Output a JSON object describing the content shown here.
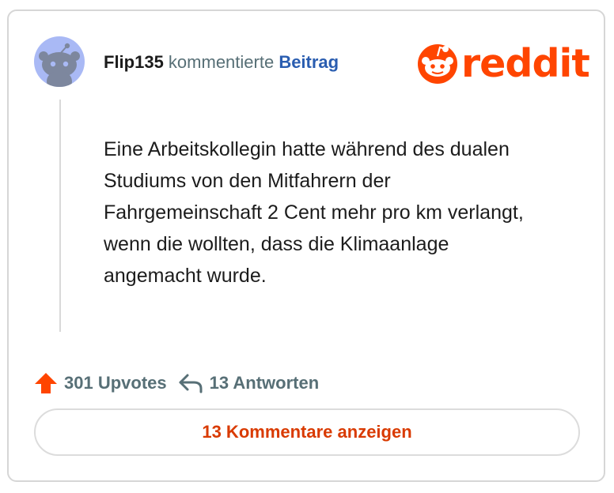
{
  "comment": {
    "username": "Flip135",
    "action_text": " kommentierte ",
    "post_link_label": "Beitrag",
    "body": "Eine Arbeitskollegin hatte während des dualen Studiums von den Mitfahrern der Fahrgemeinschaft 2 Cent mehr pro km verlangt, wenn die wollten, dass die Klimaanlage angemacht wurde."
  },
  "brand": {
    "logo_text": "reddit",
    "color": "#ff4500"
  },
  "stats": {
    "upvotes_label": "301 Upvotes",
    "replies_label": "13 Antworten"
  },
  "actions": {
    "show_comments_label": "13 Kommentare anzeigen"
  },
  "icons": {
    "avatar": "snoo-avatar-icon",
    "logo": "reddit-snoo-icon",
    "upvote": "upvote-arrow-icon",
    "reply": "reply-arrow-icon"
  },
  "colors": {
    "accent": "#ff4500",
    "link": "#2a5db0",
    "button_text": "#d93a00",
    "muted_text": "#576f76",
    "avatar_bg": "#a9b9f5"
  }
}
